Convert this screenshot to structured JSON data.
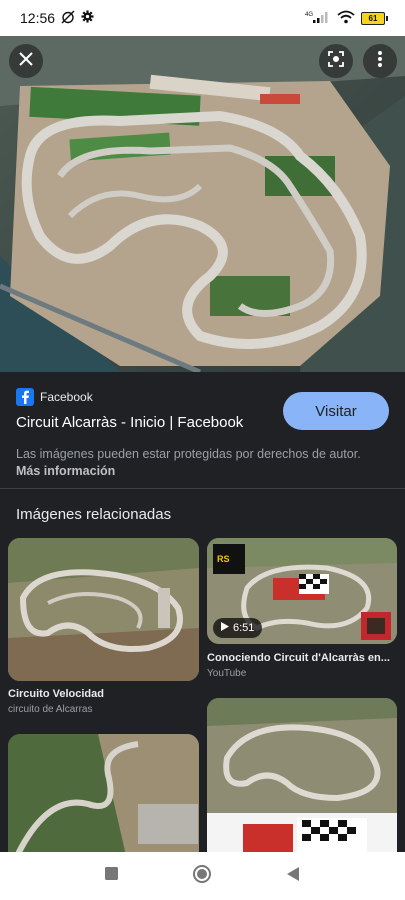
{
  "status_bar": {
    "time": "12:56",
    "battery": "61",
    "network": "4G"
  },
  "hero": {
    "close_icon": "close-icon",
    "lens_icon": "lens-icon",
    "more_icon": "more-vert-icon"
  },
  "result": {
    "source_name": "Facebook",
    "title": "Circuit Alcarràs - Inicio | Facebook",
    "visit_label": "Visitar",
    "copyright_text": "Las imágenes pueden estar protegidas por derechos de autor.",
    "more_info_label": "Más información"
  },
  "related": {
    "heading": "Imágenes relacionadas",
    "cards": [
      {
        "title": "Circuito Velocidad",
        "subtitle": "circuito de Alcarras"
      },
      {
        "title": "Conociendo Circuit d'Alcarràs en...",
        "subtitle": "YouTube",
        "duration": "6:51"
      },
      {
        "title": "",
        "subtitle": ""
      },
      {
        "title": "",
        "subtitle": ""
      }
    ]
  },
  "colors": {
    "accent": "#8ab4f8",
    "background": "#202124",
    "facebook": "#1877f2"
  }
}
